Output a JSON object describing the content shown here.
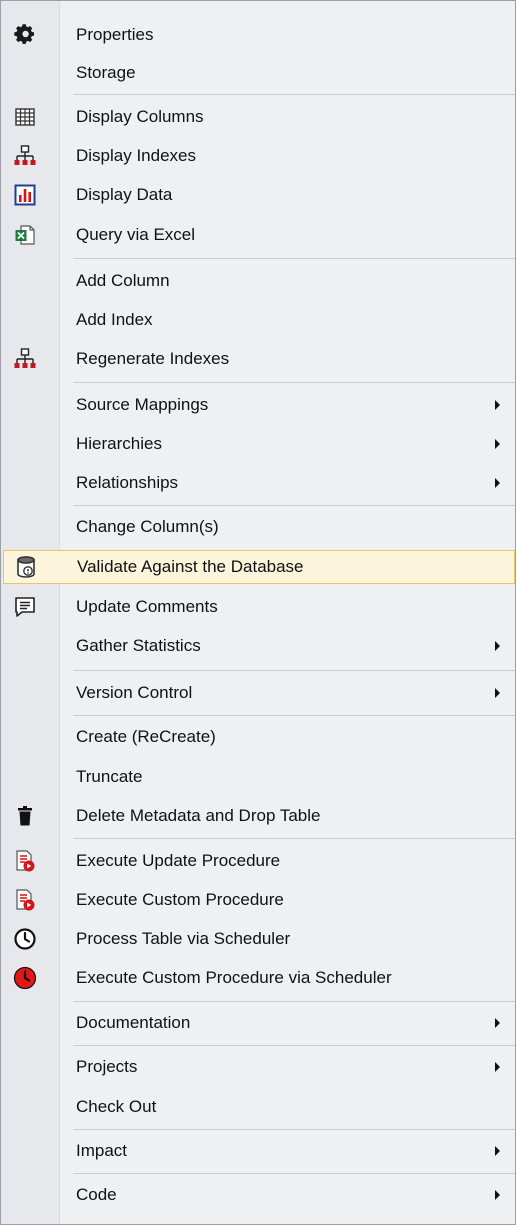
{
  "menu": {
    "items": [
      {
        "label": "Properties"
      },
      {
        "label": "Storage"
      },
      {
        "label": "Display Columns"
      },
      {
        "label": "Display Indexes"
      },
      {
        "label": "Display Data"
      },
      {
        "label": "Query via Excel"
      },
      {
        "label": "Add Column"
      },
      {
        "label": "Add Index"
      },
      {
        "label": "Regenerate Indexes"
      },
      {
        "label": "Source Mappings"
      },
      {
        "label": "Hierarchies"
      },
      {
        "label": "Relationships"
      },
      {
        "label": "Change Column(s)"
      },
      {
        "label": "Validate Against the Database"
      },
      {
        "label": "Update Comments"
      },
      {
        "label": "Gather Statistics"
      },
      {
        "label": "Version Control"
      },
      {
        "label": "Create (ReCreate)"
      },
      {
        "label": "Truncate"
      },
      {
        "label": "Delete Metadata and Drop Table"
      },
      {
        "label": "Execute Update Procedure"
      },
      {
        "label": "Execute Custom Procedure"
      },
      {
        "label": "Process Table via Scheduler"
      },
      {
        "label": "Execute Custom Procedure via Scheduler"
      },
      {
        "label": "Documentation"
      },
      {
        "label": "Projects"
      },
      {
        "label": "Check Out"
      },
      {
        "label": "Impact"
      },
      {
        "label": "Code"
      }
    ]
  },
  "icons": {
    "properties": "gear-icon",
    "display_columns": "grid-icon",
    "display_indexes": "hierarchy-icon",
    "display_data": "bar-chart-icon",
    "query_excel": "excel-icon",
    "regenerate_indexes": "hierarchy-icon",
    "validate": "database-check-icon",
    "update_comments": "comment-icon",
    "delete_drop": "trash-icon",
    "exec_update": "procedure-run-icon",
    "exec_custom": "procedure-run-icon",
    "process_scheduler": "clock-icon",
    "exec_custom_scheduler": "red-clock-icon"
  },
  "colors": {
    "menu_bg": "#eef0f2",
    "gutter_bg": "#e6e8ec",
    "highlight_bg": "#fdf4dc",
    "highlight_border": "#e8c76a",
    "separator": "#c9ccd1",
    "accent_red": "#d41414"
  }
}
